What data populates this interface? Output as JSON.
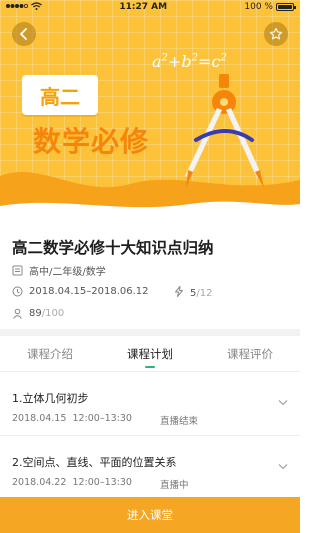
{
  "status_bar": {
    "time": "11:27 AM",
    "battery": "100 %",
    "battery_level": 1.0
  },
  "hero": {
    "grade": "高二",
    "subject": "数学必修",
    "formula": {
      "a": "a",
      "plus": "+",
      "b": "b",
      "eq": "=",
      "c": "c",
      "exp": "2"
    }
  },
  "course": {
    "title": "高二数学必修十大知识点归纳",
    "category": "高中/二年级/数学",
    "date_range": "2018.04.15–2018.06.12",
    "lessons_done": "5",
    "lessons_total": "/12",
    "enrolled": "89",
    "capacity": "/100"
  },
  "tabs": [
    {
      "label": "课程介绍"
    },
    {
      "label": "课程计划"
    },
    {
      "label": "课程评价"
    }
  ],
  "lessons": [
    {
      "title": "1.立体几何初步",
      "date": "2018.04.15",
      "time": "12:00–13:30",
      "status": "直播结束"
    },
    {
      "title": "2.空间点、直线、平面的位置关系",
      "date": "2018.04.22",
      "time": "12:00–13:30",
      "status": "直播中"
    }
  ],
  "enter_button": "进入课堂",
  "colors": {
    "brand": "#f5a623",
    "hero_bg": "#fcc33a",
    "tab_indicator": "#2fb27a"
  }
}
